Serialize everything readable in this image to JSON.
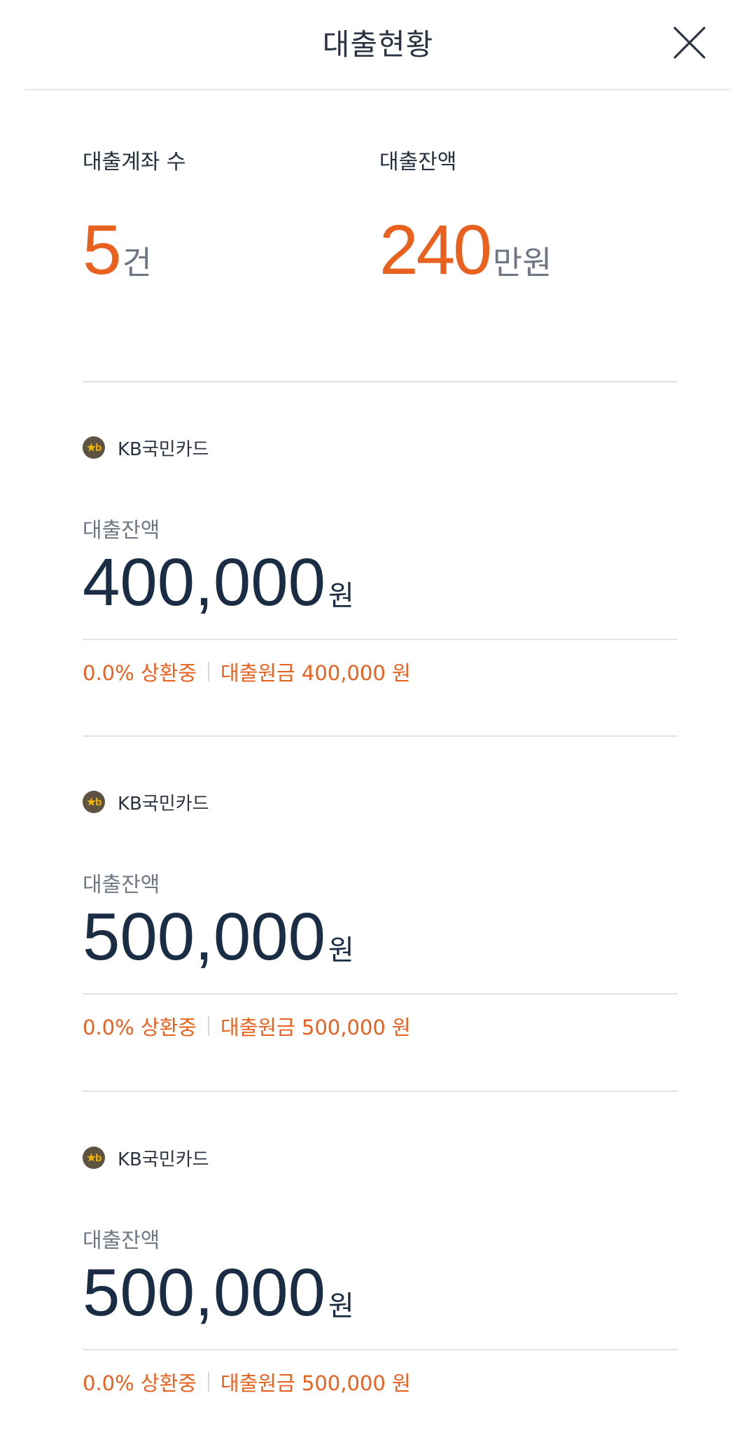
{
  "header": {
    "title": "대출현황",
    "close_icon": "close-icon"
  },
  "summary": {
    "accounts_label": "대출계좌 수",
    "accounts_value": "5",
    "accounts_unit": "건",
    "balance_label": "대출잔액",
    "balance_value": "240",
    "balance_unit": "만원"
  },
  "colors": {
    "accent": "#e8611f",
    "primary_text": "#1b2d44",
    "bank_logo_bg": "#5e5241",
    "bank_logo_fg": "#f4b400"
  },
  "loans": [
    {
      "bank_icon": "kb-logo-icon",
      "bank_name": "KB국민카드",
      "balance_label": "대출잔액",
      "balance_value": "400,000",
      "balance_unit": "원",
      "repay_status": "0.0% 상환중",
      "principal": "대출원금 400,000 원"
    },
    {
      "bank_icon": "kb-logo-icon",
      "bank_name": "KB국민카드",
      "balance_label": "대출잔액",
      "balance_value": "500,000",
      "balance_unit": "원",
      "repay_status": "0.0% 상환중",
      "principal": "대출원금 500,000 원"
    },
    {
      "bank_icon": "kb-logo-icon",
      "bank_name": "KB국민카드",
      "balance_label": "대출잔액",
      "balance_value": "500,000",
      "balance_unit": "원",
      "repay_status": "0.0% 상환중",
      "principal": "대출원금 500,000 원"
    }
  ]
}
